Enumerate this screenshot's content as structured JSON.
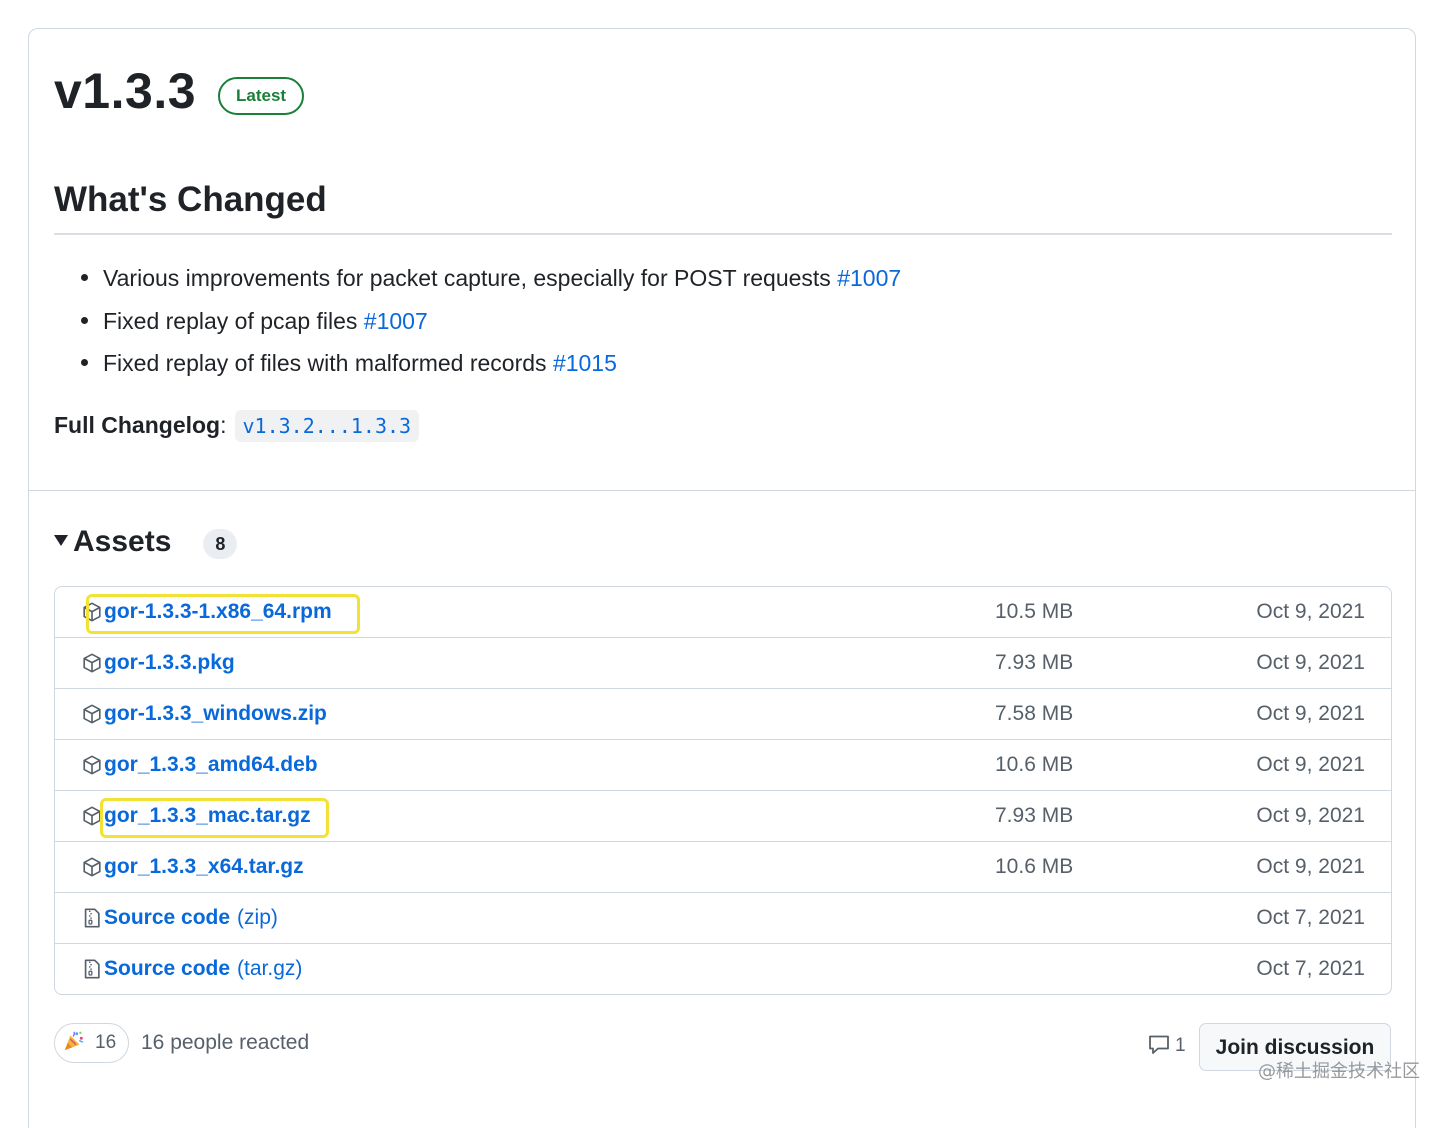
{
  "release": {
    "title": "v1.3.3",
    "badge": "Latest"
  },
  "notes": {
    "heading": "What's Changed",
    "items": [
      {
        "text": "Various improvements for packet capture, especially for POST requests ",
        "link": "#1007"
      },
      {
        "text": "Fixed replay of pcap files ",
        "link": "#1007"
      },
      {
        "text": "Fixed replay of files with malformed records ",
        "link": "#1015"
      }
    ],
    "changelog_label": "Full Changelog",
    "changelog_colon": ":",
    "changelog_link": "v1.3.2...1.3.3"
  },
  "assets": {
    "label": "Assets",
    "count": "8",
    "rows": [
      {
        "name": "gor-1.3.3-1.x86_64.rpm",
        "ext": "",
        "size": "10.5 MB",
        "date": "Oct 9, 2021",
        "icon": "package-icon"
      },
      {
        "name": "gor-1.3.3.pkg",
        "ext": "",
        "size": "7.93 MB",
        "date": "Oct 9, 2021",
        "icon": "package-icon"
      },
      {
        "name": "gor-1.3.3_windows.zip",
        "ext": "",
        "size": "7.58 MB",
        "date": "Oct 9, 2021",
        "icon": "package-icon"
      },
      {
        "name": "gor_1.3.3_amd64.deb",
        "ext": "",
        "size": "10.6 MB",
        "date": "Oct 9, 2021",
        "icon": "package-icon"
      },
      {
        "name": "gor_1.3.3_mac.tar.gz",
        "ext": "",
        "size": "7.93 MB",
        "date": "Oct 9, 2021",
        "icon": "package-icon"
      },
      {
        "name": "gor_1.3.3_x64.tar.gz",
        "ext": "",
        "size": "10.6 MB",
        "date": "Oct 9, 2021",
        "icon": "package-icon"
      },
      {
        "name": "Source code",
        "ext": "(zip)",
        "size": "",
        "date": "Oct 7, 2021",
        "icon": "file-zip-icon"
      },
      {
        "name": "Source code",
        "ext": "(tar.gz)",
        "size": "",
        "date": "Oct 7, 2021",
        "icon": "file-zip-icon"
      }
    ]
  },
  "footer": {
    "reaction_count": "16",
    "reaction_icon": "tada-icon",
    "reaction_text": "16 people reacted",
    "comment_count": "1",
    "join_label": "Join discussion"
  },
  "watermark": "@稀土掘金技术社区",
  "colors": {
    "link": "#0969da",
    "latest": "#1a7f37",
    "highlight": "#f2e235",
    "muted": "#57606a"
  }
}
